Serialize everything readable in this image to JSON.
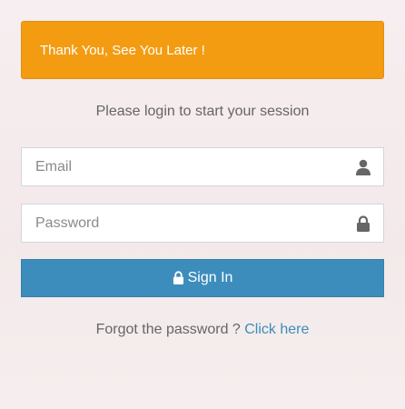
{
  "alert": {
    "message": "Thank You, See You Later !"
  },
  "login": {
    "subtitle": "Please login to start your session",
    "email_placeholder": "Email",
    "password_placeholder": "Password",
    "signin_label": "Sign In",
    "forgot_text": "Forgot the password ? ",
    "forgot_link": "Click here"
  },
  "icons": {
    "email": "user-icon",
    "password": "lock-icon",
    "signin": "lock-icon"
  },
  "colors": {
    "alert": "#f39c12",
    "button": "#3c8dbc",
    "link": "#3c8dbc"
  }
}
